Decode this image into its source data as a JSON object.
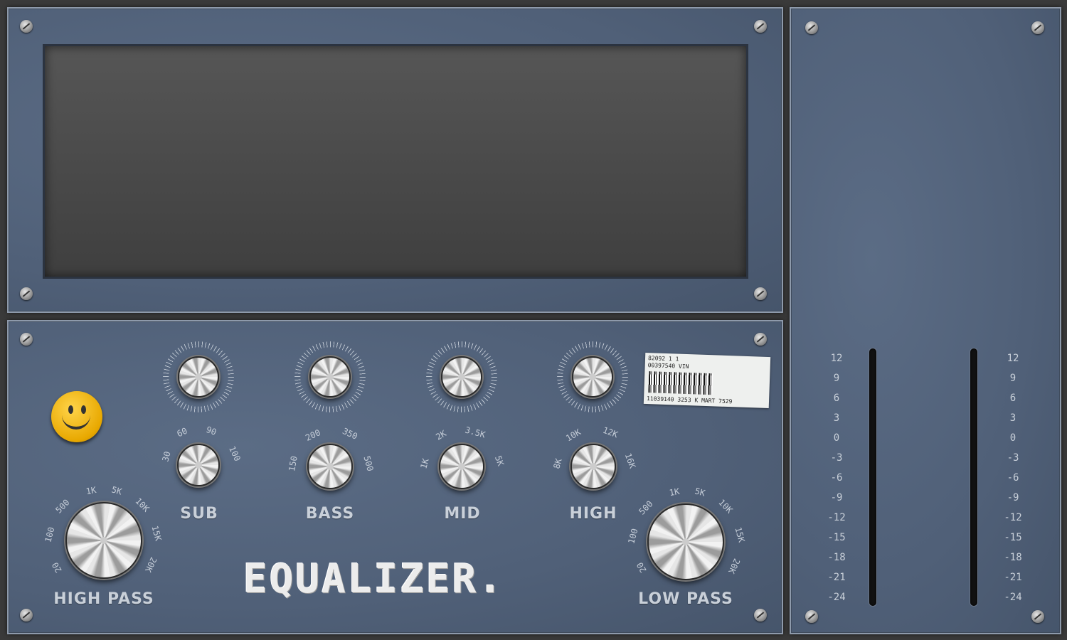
{
  "title": "EQUALIZER.",
  "knobs": {
    "sub_top": {},
    "bass_top": {},
    "mid_top": {},
    "high_top": {},
    "sub": {
      "label": "SUB",
      "ticks": [
        "30",
        "60",
        "90",
        "100"
      ]
    },
    "bass": {
      "label": "BASS",
      "ticks": [
        "150",
        "200",
        "350",
        "500"
      ]
    },
    "mid": {
      "label": "MID",
      "ticks": [
        "1K",
        "2K",
        "3.5K",
        "5K"
      ]
    },
    "high": {
      "label": "HIGH",
      "ticks": [
        "8K",
        "10K",
        "12K",
        "16K"
      ]
    },
    "high_pass": {
      "label": "HIGH PASS",
      "ticks": [
        "20",
        "100",
        "500",
        "1K",
        "5K",
        "10K",
        "15K",
        "20K"
      ]
    },
    "low_pass": {
      "label": "LOW PASS",
      "ticks": [
        "20",
        "100",
        "500",
        "1K",
        "5K",
        "10K",
        "15K",
        "20K"
      ]
    }
  },
  "sticker": {
    "line1": "82092  1 1",
    "line2": "00397540 VIN",
    "line3": "11039140 3253 K MART 7529"
  },
  "meter": {
    "scale": [
      "12",
      "9",
      "6",
      "3",
      "0",
      "-3",
      "-6",
      "-9",
      "-12",
      "-15",
      "-18",
      "-21",
      "-24"
    ]
  }
}
